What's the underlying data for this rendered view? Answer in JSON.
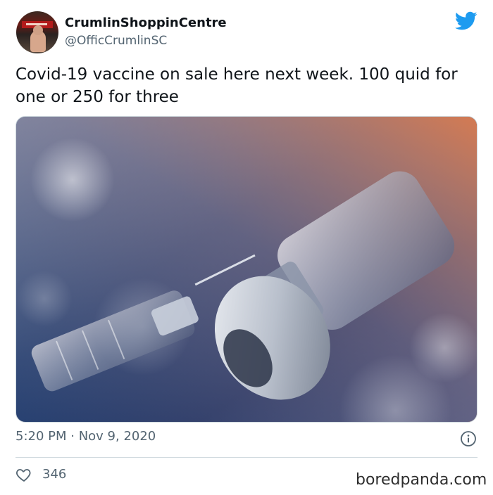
{
  "author": {
    "display_name": "CrumlinShoppinCentre",
    "handle": "@OfficCrumlinSC"
  },
  "tweet": {
    "text": "Covid-19 vaccine on sale here next week. 100 quid for one or 250 for three",
    "timestamp": "5:20 PM · Nov 9, 2020",
    "like_count": "346"
  },
  "media": {
    "description_icon": "vaccine-vial-syringe-photo"
  },
  "icons": {
    "brand": "twitter-bird-icon",
    "info": "info-icon",
    "like": "heart-icon"
  },
  "colors": {
    "twitter_blue": "#1d9bf0",
    "secondary_text": "#536471",
    "primary_text": "#0f1419",
    "divider": "#cfd9de"
  },
  "watermark": "boredpanda.com"
}
